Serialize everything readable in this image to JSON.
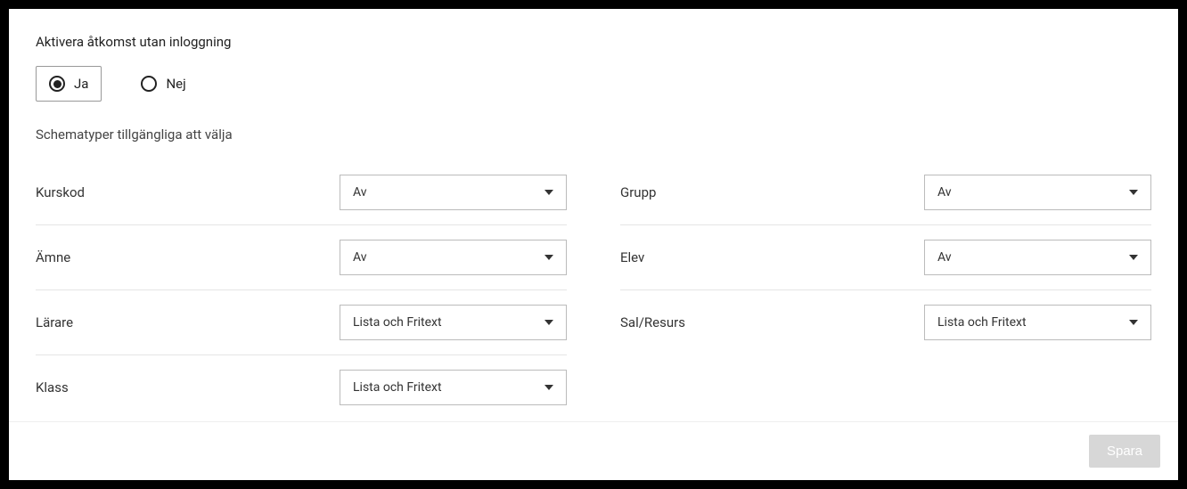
{
  "access": {
    "title": "Aktivera åtkomst utan inloggning",
    "options": {
      "yes": "Ja",
      "no": "Nej"
    },
    "selected": "yes"
  },
  "schemaTypes": {
    "title": "Schematyper tillgängliga att välja",
    "left": [
      {
        "label": "Kurskod",
        "value": "Av"
      },
      {
        "label": "Ämne",
        "value": "Av"
      },
      {
        "label": "Lärare",
        "value": "Lista och Fritext"
      },
      {
        "label": "Klass",
        "value": "Lista och Fritext"
      }
    ],
    "right": [
      {
        "label": "Grupp",
        "value": "Av"
      },
      {
        "label": "Elev",
        "value": "Av"
      },
      {
        "label": "Sal/Resurs",
        "value": "Lista och Fritext"
      }
    ]
  },
  "footer": {
    "save": "Spara"
  }
}
